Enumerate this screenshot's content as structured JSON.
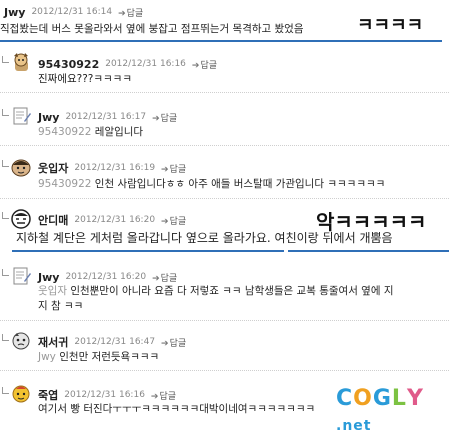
{
  "comments": [
    {
      "name": "Jwy",
      "date": "2012/12/31 16:14",
      "reply": "답글",
      "mention": "",
      "text": "직접봤는데 버스 못올라와서 옆에 붕잡고 점프뛰는거 목격하고 봤었음"
    },
    {
      "name": "95430922",
      "date": "2012/12/31 16:16",
      "reply": "답글",
      "mention": "",
      "text": "진짜에요???ㅋㅋㅋㅋ"
    },
    {
      "name": "Jwy",
      "date": "2012/12/31 16:17",
      "reply": "답글",
      "mention": "95430922",
      "text": "레알입니다"
    },
    {
      "name": "웃입자",
      "date": "2012/12/31 16:19",
      "reply": "답글",
      "mention": "95430922",
      "text": "인천 사람입니다ㅎㅎ 아주 애들 버스탈때 가관입니다 ㅋㅋㅋㅋㅋㅋ"
    },
    {
      "name": "안디매",
      "date": "2012/12/31 16:20",
      "reply": "답글",
      "mention": "",
      "text": "지하철 계단은 게처럼 올라갑니다 옆으로 올라가요. 여친이랑 뒤에서 개뿜음"
    },
    {
      "name": "Jwy",
      "date": "2012/12/31 16:20",
      "reply": "답글",
      "mention": "웃입자",
      "text": "인천뿐만이 아니라 요즘 다 저렇죠 ㅋㅋ 남학생들은 교복 통줄여서 옆에 지",
      "text2": "지 참 ㅋㅋ"
    },
    {
      "name": "재서귀",
      "date": "2012/12/31 16:47",
      "reply": "답글",
      "mention": "Jwy",
      "text": "인천만 저런듯욕ㅋㅋㅋ"
    },
    {
      "name": "죽엽",
      "date": "2012/12/31 16:16",
      "reply": "답글",
      "mention": "",
      "text": "여기서 빵 터진다ㅜㅜㅜㅋㅋㅋㅋㅋㅋ대박이네여ㅋㅋㅋㅋㅋㅋㅋ"
    }
  ],
  "captions": {
    "first": "ㅋㅋㅋㅋ",
    "fifth": "악ㅋㅋㅋㅋㅋ"
  },
  "brand": "COGLY.net"
}
